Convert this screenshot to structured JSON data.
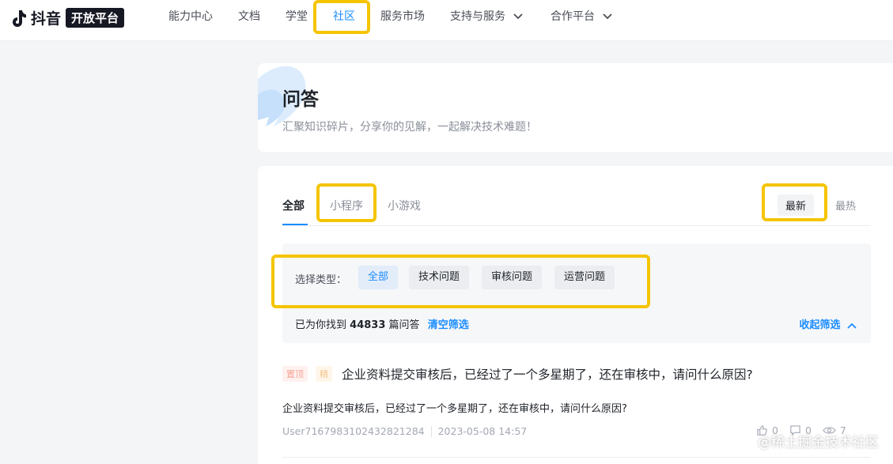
{
  "header": {
    "brand": "抖音",
    "badge": "开放平台",
    "nav": [
      {
        "label": "能力中心"
      },
      {
        "label": "文档"
      },
      {
        "label": "学堂"
      },
      {
        "label": "社区",
        "active": true
      },
      {
        "label": "服务市场"
      },
      {
        "label": "支持与服务",
        "dropdown": true
      },
      {
        "label": "合作平台",
        "dropdown": true
      }
    ]
  },
  "hero": {
    "title": "问答",
    "subtitle": "汇聚知识碎片，分享你的见解，一起解决技术难题！"
  },
  "tabs": [
    {
      "label": "全部",
      "active": true
    },
    {
      "label": "小程序"
    },
    {
      "label": "小游戏"
    }
  ],
  "sort": [
    {
      "label": "最新",
      "active": true
    },
    {
      "label": "最热"
    }
  ],
  "filter": {
    "label": "选择类型：",
    "options": [
      {
        "label": "全部",
        "active": true
      },
      {
        "label": "技术问题"
      },
      {
        "label": "审核问题"
      },
      {
        "label": "运营问题"
      }
    ],
    "result_prefix": "已为你找到",
    "result_count": "44833",
    "result_suffix": "篇问答",
    "clear_label": "清空筛选",
    "collapse_label": "收起筛选"
  },
  "question": {
    "tags": [
      "置顶",
      "精"
    ],
    "title": "企业资料提交审核后，已经过了一个多星期了，还在审核中，请问什么原因?",
    "body": "企业资料提交审核后，已经过了一个多星期了，还在审核中，请问什么原因?",
    "author": "User7167983102432821284",
    "date": "2023-05-08 14:57",
    "likes": "0",
    "comments": "0",
    "views": "7"
  },
  "watermark": "@稀土掘金技术社区",
  "colors": {
    "accent": "#1a8cff",
    "highlight": "#f5c400"
  }
}
